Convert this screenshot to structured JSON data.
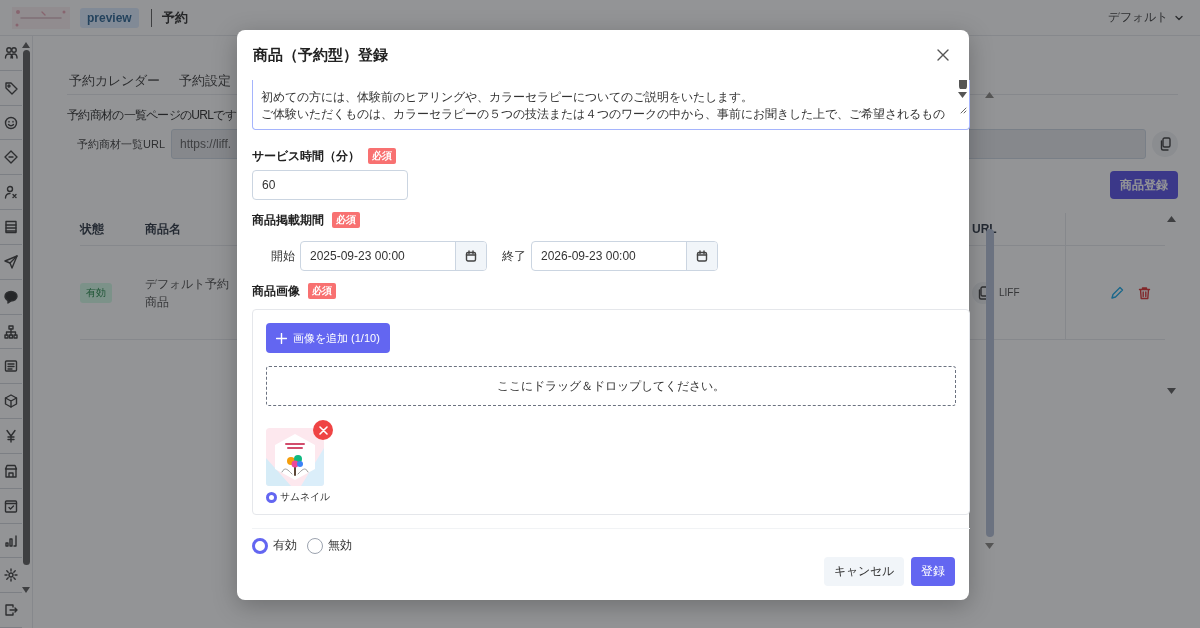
{
  "header": {
    "badge": "preview",
    "title": "予約",
    "view_select": "デフォルト"
  },
  "tabs": [
    {
      "label": "予約カレンダー",
      "selected": false
    },
    {
      "label": "予約設定",
      "selected": false
    }
  ],
  "url_section": {
    "description": "予約商材の一覧ページのURLです",
    "label": "予約商材一覧URL",
    "value": "https://liff."
  },
  "register_button": "商品登録",
  "table": {
    "columns": [
      "状態",
      "商品名",
      "URL"
    ],
    "rows": [
      {
        "status": "有効",
        "name": "デフォルト予約商品",
        "url": "LIFF"
      }
    ]
  },
  "dialog": {
    "title": "商品（予約型）登録",
    "description_lines": [
      "初めての方には、体験前のヒアリングや、カラーセラピーについてのご説明をいたします。",
      "ご体験いただくものは、カラーセラピーの５つの技法または４つのワークの中から、事前にお聞きした上で、ご希望されるもの"
    ],
    "fields": [
      {
        "kind": "number",
        "label": "サービス時間（分）",
        "required": "必須",
        "value": "60"
      },
      {
        "kind": "period",
        "label": "商品掲載期間",
        "required": "必須",
        "start_label": "開始",
        "start": "2025-09-23 00:00",
        "end_label": "終了",
        "end": "2026-09-23 00:00"
      },
      {
        "kind": "images",
        "label": "商品画像",
        "required": "必須",
        "add_button": "画像を追加 (1/10)",
        "dropzone": "ここにドラッグ＆ドロップしてください。",
        "images": [
          {
            "kind": "picture",
            "thumbnail_label": "サムネイル",
            "selected": true
          }
        ]
      }
    ],
    "status_options": [
      {
        "label": "有効",
        "selected": true
      },
      {
        "label": "無効",
        "selected": false
      }
    ],
    "buttons": [
      {
        "label": "キャンセル",
        "kind": "secondary"
      },
      {
        "label": "登録",
        "kind": "primary"
      }
    ]
  }
}
